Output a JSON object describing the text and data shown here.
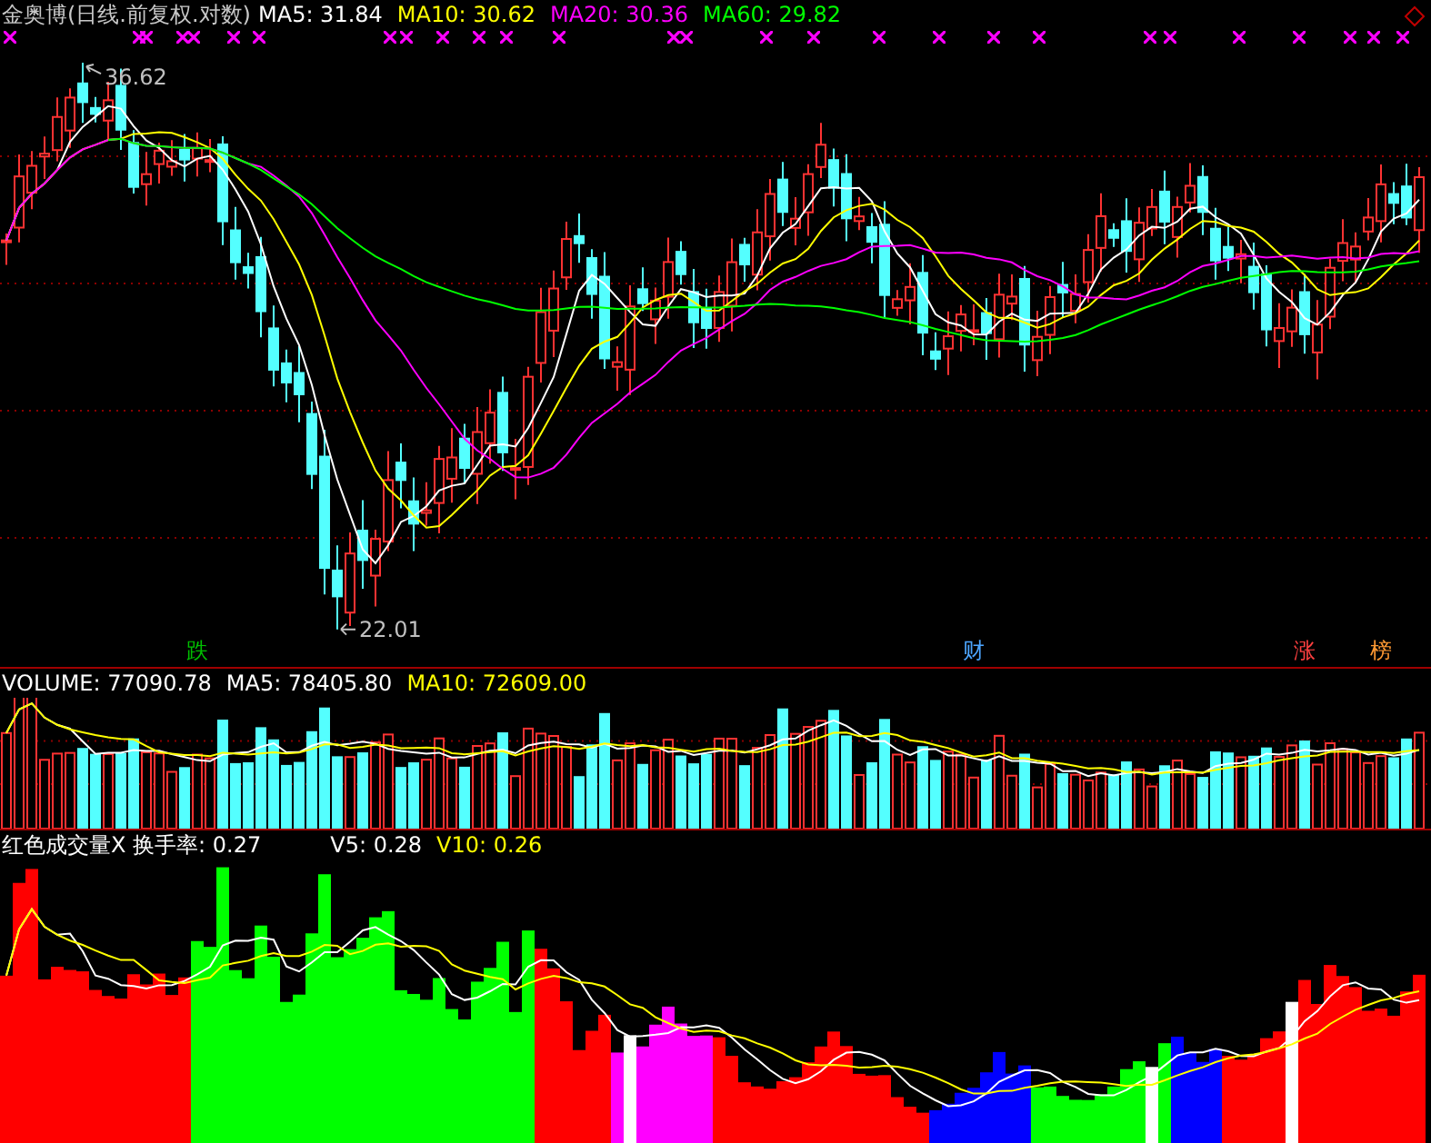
{
  "main_panel": {
    "title": "金奥博(日线.前复权.对数)",
    "legend": [
      {
        "label": "MA5: 31.84",
        "color": "#ffffff"
      },
      {
        "label": "MA10: 30.62",
        "color": "#ffff00"
      },
      {
        "label": "MA20: 30.36",
        "color": "#ff00ff"
      },
      {
        "label": "MA60: 29.82",
        "color": "#00ff00"
      }
    ],
    "high_label": "36.62",
    "low_label": "22.01",
    "events": [
      {
        "label": "跌",
        "color": "#00c000"
      },
      {
        "label": "财",
        "color": "#4da6ff"
      },
      {
        "label": "涨",
        "color": "#ff4040"
      },
      {
        "label": "榜",
        "color": "#ff9933"
      }
    ]
  },
  "volume_panel": {
    "legend": [
      {
        "label": "VOLUME: 77090.78",
        "color": "#ffffff"
      },
      {
        "label": "MA5: 78405.80",
        "color": "#ffffff"
      },
      {
        "label": "MA10: 72609.00",
        "color": "#ffff00"
      }
    ]
  },
  "turnover_panel": {
    "legend": [
      {
        "label": "红色成交量X 换手率: 0.27",
        "color": "#ffffff"
      },
      {
        "label": "V5: 0.28",
        "color": "#ffffff"
      },
      {
        "label": "V10: 0.26",
        "color": "#ffff00"
      }
    ]
  }
}
